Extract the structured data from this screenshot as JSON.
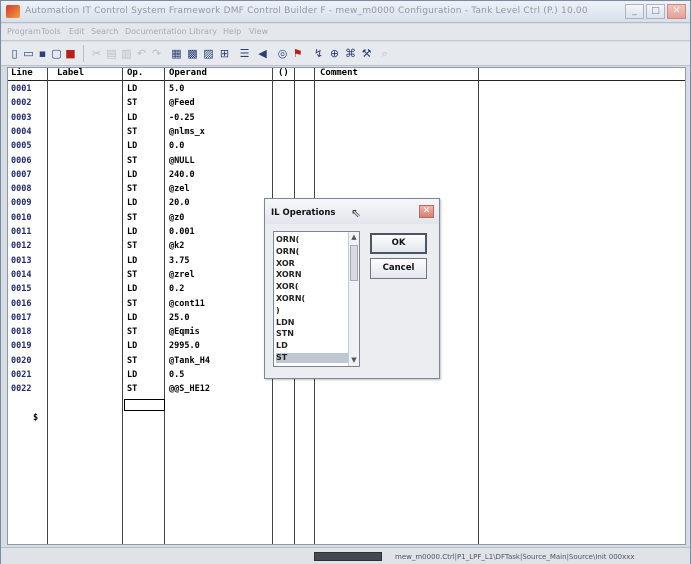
{
  "window": {
    "title": "Automation IT Control System Framework DMF Control Builder F - mew_m0000 Configuration - Tank Level Ctrl (P.) 10.00",
    "menu": [
      "Program",
      "Tools",
      "Edit",
      "Search",
      "Documentation",
      "Library",
      "Help",
      "View"
    ]
  },
  "editor": {
    "columns": {
      "line": "Line",
      "label": "Label",
      "op": "Op.",
      "operand": "Operand",
      "paren": "()",
      "comment": "Comment"
    },
    "rows": [
      {
        "line": "0001",
        "op": "LD",
        "operand": "5.0"
      },
      {
        "line": "0002",
        "op": "ST",
        "operand": "@Feed"
      },
      {
        "line": "0003",
        "op": "LD",
        "operand": "-0.25"
      },
      {
        "line": "0004",
        "op": "ST",
        "operand": "@nlms_x"
      },
      {
        "line": "0005",
        "op": "LD",
        "operand": "0.0"
      },
      {
        "line": "0006",
        "op": "ST",
        "operand": "@NULL"
      },
      {
        "line": "0007",
        "op": "LD",
        "operand": "240.0"
      },
      {
        "line": "0008",
        "op": "ST",
        "operand": "@zel"
      },
      {
        "line": "0009",
        "op": "LD",
        "operand": "20.0"
      },
      {
        "line": "0010",
        "op": "ST",
        "operand": "@z0"
      },
      {
        "line": "0011",
        "op": "LD",
        "operand": "0.001"
      },
      {
        "line": "0012",
        "op": "ST",
        "operand": "@k2"
      },
      {
        "line": "0013",
        "op": "LD",
        "operand": "3.75"
      },
      {
        "line": "0014",
        "op": "ST",
        "operand": "@zrel"
      },
      {
        "line": "0015",
        "op": "LD",
        "operand": "0.2"
      },
      {
        "line": "0016",
        "op": "ST",
        "operand": "@cont11"
      },
      {
        "line": "0017",
        "op": "LD",
        "operand": "25.0"
      },
      {
        "line": "0018",
        "op": "ST",
        "operand": "@Eqmis"
      },
      {
        "line": "0019",
        "op": "LD",
        "operand": "2995.0"
      },
      {
        "line": "0020",
        "op": "ST",
        "operand": "@Tank_H4"
      },
      {
        "line": "0021",
        "op": "LD",
        "operand": "0.5"
      },
      {
        "line": "0022",
        "op": "ST",
        "operand": "@@S_HE12"
      }
    ],
    "end_marker": "$"
  },
  "dialog": {
    "title": "IL Operations",
    "options": [
      "ORN(",
      "ORN(",
      "XOR",
      "XORN",
      "XOR(",
      "XORN(",
      ")",
      "LDN",
      "STN",
      "LD",
      "ST"
    ],
    "selected_index": 10,
    "ok_label": "OK",
    "cancel_label": "Cancel"
  },
  "statusbar": {
    "path": "mew_m0000.Ctrl|P1_LPF_L1\\DFTask|Source_Main|Source\\Init 000xxx"
  }
}
